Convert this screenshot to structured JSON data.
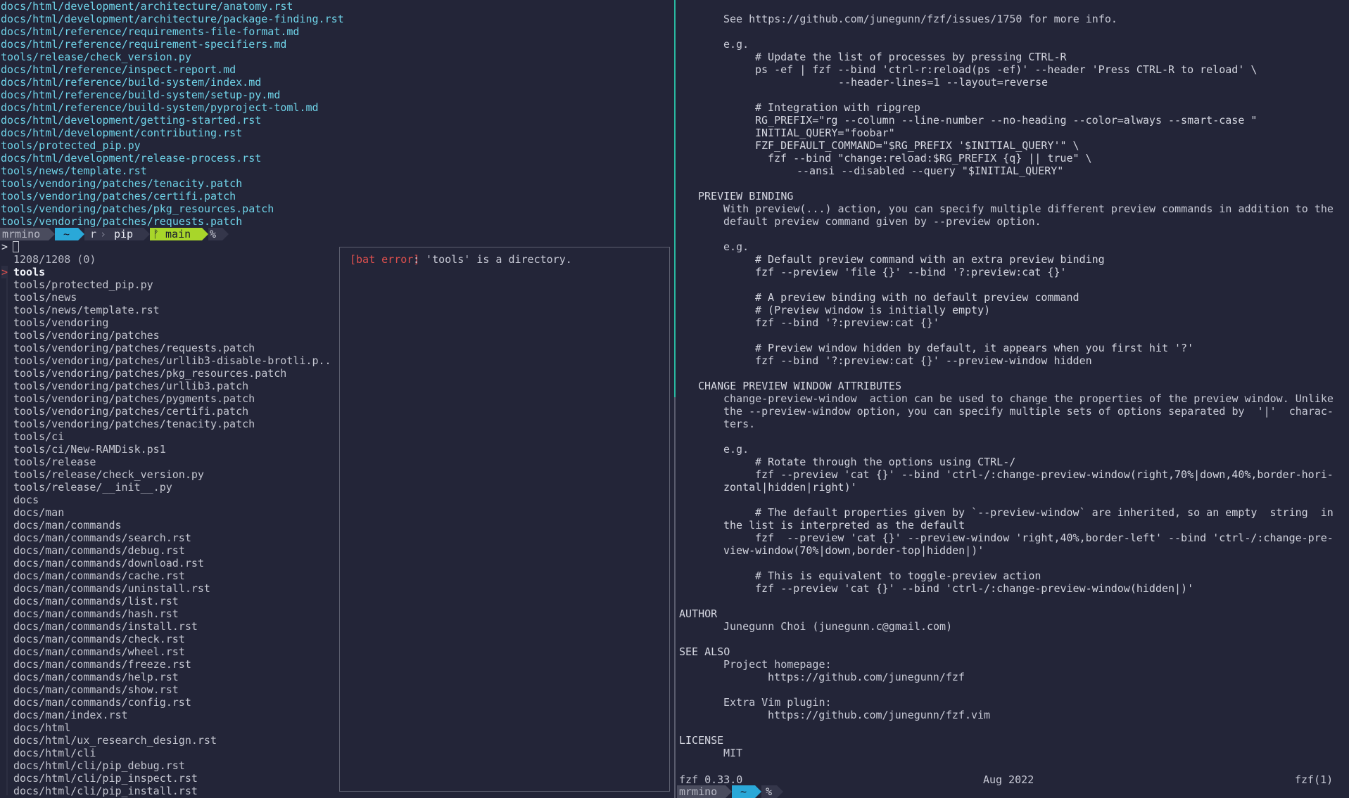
{
  "history_lines": [
    "docs/html/development/architecture/anatomy.rst",
    "docs/html/development/architecture/package-finding.rst",
    "docs/html/reference/requirements-file-format.md",
    "docs/html/reference/requirement-specifiers.md",
    "tools/release/check_version.py",
    "docs/html/reference/inspect-report.md",
    "docs/html/reference/build-system/index.md",
    "docs/html/reference/build-system/setup-py.md",
    "docs/html/reference/build-system/pyproject-toml.md",
    "docs/html/development/getting-started.rst",
    "docs/html/development/contributing.rst",
    "tools/protected_pip.py",
    "docs/html/development/release-process.rst",
    "tools/news/template.rst",
    "tools/vendoring/patches/tenacity.patch",
    "tools/vendoring/patches/certifi.patch",
    "tools/vendoring/patches/pkg_resources.patch",
    "tools/vendoring/patches/requests.patch"
  ],
  "prompt": {
    "user": "mrmino",
    "home": "~",
    "dir1": "r",
    "dir2": "pip",
    "branch": "ᚠ main",
    "symbol": "%"
  },
  "fzf": {
    "query_prompt": ">",
    "count": "1208/1208 (0)",
    "pointer": ">",
    "selected": "tools",
    "items": [
      "tools/protected_pip.py",
      "tools/news",
      "tools/news/template.rst",
      "tools/vendoring",
      "tools/vendoring/patches",
      "tools/vendoring/patches/requests.patch",
      "tools/vendoring/patches/urllib3-disable-brotli.p..",
      "tools/vendoring/patches/pkg_resources.patch",
      "tools/vendoring/patches/urllib3.patch",
      "tools/vendoring/patches/pygments.patch",
      "tools/vendoring/patches/certifi.patch",
      "tools/vendoring/patches/tenacity.patch",
      "tools/ci",
      "tools/ci/New-RAMDisk.ps1",
      "tools/release",
      "tools/release/check_version.py",
      "tools/release/__init__.py",
      "docs",
      "docs/man",
      "docs/man/commands",
      "docs/man/commands/search.rst",
      "docs/man/commands/debug.rst",
      "docs/man/commands/download.rst",
      "docs/man/commands/cache.rst",
      "docs/man/commands/uninstall.rst",
      "docs/man/commands/list.rst",
      "docs/man/commands/hash.rst",
      "docs/man/commands/install.rst",
      "docs/man/commands/check.rst",
      "docs/man/commands/wheel.rst",
      "docs/man/commands/freeze.rst",
      "docs/man/commands/help.rst",
      "docs/man/commands/show.rst",
      "docs/man/commands/config.rst",
      "docs/man/index.rst",
      "docs/html",
      "docs/html/ux_research_design.rst",
      "docs/html/cli",
      "docs/html/cli/pip_debug.rst",
      "docs/html/cli/pip_inspect.rst",
      "docs/html/cli/pip_install.rst"
    ],
    "preview_error_tag": "[bat error]",
    "preview_error_msg": ": 'tools' is a directory."
  },
  "manpage": {
    "lines": [
      {
        "indent": 66,
        "kind": "text",
        "text": "See https://github.com/junegunn/fzf/issues/1750 for more info."
      },
      {
        "indent": 0,
        "kind": "blank",
        "text": ""
      },
      {
        "indent": 66,
        "kind": "text",
        "text": "e.g."
      },
      {
        "indent": 111,
        "kind": "code",
        "text": "# Update the list of processes by pressing CTRL-R"
      },
      {
        "indent": 111,
        "kind": "code",
        "text": "ps -ef | fzf --bind 'ctrl-r:reload(ps -ef)' --header 'Press CTRL-R to reload' \\"
      },
      {
        "indent": 229,
        "kind": "code",
        "text": "--header-lines=1 --layout=reverse"
      },
      {
        "indent": 0,
        "kind": "blank",
        "text": ""
      },
      {
        "indent": 111,
        "kind": "code",
        "text": "# Integration with ripgrep"
      },
      {
        "indent": 111,
        "kind": "code",
        "text": "RG_PREFIX=\"rg --column --line-number --no-heading --color=always --smart-case \""
      },
      {
        "indent": 111,
        "kind": "code",
        "text": "INITIAL_QUERY=\"foobar\""
      },
      {
        "indent": 111,
        "kind": "code",
        "text": "FZF_DEFAULT_COMMAND=\"$RG_PREFIX '$INITIAL_QUERY'\" \\"
      },
      {
        "indent": 129,
        "kind": "code",
        "text": "fzf --bind \"change:reload:$RG_PREFIX {q} || true\" \\"
      },
      {
        "indent": 170,
        "kind": "code",
        "text": "--ansi --disabled --query \"$INITIAL_QUERY\""
      },
      {
        "indent": 0,
        "kind": "blank",
        "text": ""
      },
      {
        "indent": 30,
        "kind": "heading",
        "text": "PREVIEW BINDING"
      },
      {
        "indent": 66,
        "kind": "text",
        "text": "With preview(...) action, you can specify multiple different preview commands in addition to the"
      },
      {
        "indent": 66,
        "kind": "text",
        "text": "default preview command given by --preview option."
      },
      {
        "indent": 0,
        "kind": "blank",
        "text": ""
      },
      {
        "indent": 66,
        "kind": "text",
        "text": "e.g."
      },
      {
        "indent": 111,
        "kind": "code",
        "text": "# Default preview command with an extra preview binding"
      },
      {
        "indent": 111,
        "kind": "code",
        "text": "fzf --preview 'file {}' --bind '?:preview:cat {}'"
      },
      {
        "indent": 0,
        "kind": "blank",
        "text": ""
      },
      {
        "indent": 111,
        "kind": "code",
        "text": "# A preview binding with no default preview command"
      },
      {
        "indent": 111,
        "kind": "code",
        "text": "# (Preview window is initially empty)"
      },
      {
        "indent": 111,
        "kind": "code",
        "text": "fzf --bind '?:preview:cat {}'"
      },
      {
        "indent": 0,
        "kind": "blank",
        "text": ""
      },
      {
        "indent": 111,
        "kind": "code",
        "text": "# Preview window hidden by default, it appears when you first hit '?'"
      },
      {
        "indent": 111,
        "kind": "code",
        "text": "fzf --bind '?:preview:cat {}' --preview-window hidden"
      },
      {
        "indent": 0,
        "kind": "blank",
        "text": ""
      },
      {
        "indent": 30,
        "kind": "heading",
        "text": "CHANGE PREVIEW WINDOW ATTRIBUTES"
      },
      {
        "indent": 66,
        "kind": "text",
        "text": "change-preview-window  action can be used to change the properties of the preview window. Unlike"
      },
      {
        "indent": 66,
        "kind": "text",
        "text": "the --preview-window option, you can specify multiple sets of options separated by  '|'  charac-"
      },
      {
        "indent": 66,
        "kind": "text",
        "text": "ters."
      },
      {
        "indent": 0,
        "kind": "blank",
        "text": ""
      },
      {
        "indent": 66,
        "kind": "text",
        "text": "e.g."
      },
      {
        "indent": 111,
        "kind": "code",
        "text": "# Rotate through the options using CTRL-/"
      },
      {
        "indent": 111,
        "kind": "code",
        "text": "fzf --preview 'cat {}' --bind 'ctrl-/:change-preview-window(right,70%|down,40%,border-hori-"
      },
      {
        "indent": 66,
        "kind": "code",
        "text": "zontal|hidden|right)'"
      },
      {
        "indent": 0,
        "kind": "blank",
        "text": ""
      },
      {
        "indent": 111,
        "kind": "code",
        "text": "# The default properties given by `--preview-window` are inherited, so an empty  string  in"
      },
      {
        "indent": 66,
        "kind": "code",
        "text": "the list is interpreted as the default"
      },
      {
        "indent": 111,
        "kind": "code",
        "text": "fzf  --preview 'cat {}' --preview-window 'right,40%,border-left' --bind 'ctrl-/:change-pre-"
      },
      {
        "indent": 66,
        "kind": "code",
        "text": "view-window(70%|down,border-top|hidden|)'"
      },
      {
        "indent": 0,
        "kind": "blank",
        "text": ""
      },
      {
        "indent": 111,
        "kind": "code",
        "text": "# This is equivalent to toggle-preview action"
      },
      {
        "indent": 111,
        "kind": "code",
        "text": "fzf --preview 'cat {}' --bind 'ctrl-/:change-preview-window(hidden|)'"
      },
      {
        "indent": 0,
        "kind": "blank",
        "text": ""
      },
      {
        "indent": 3,
        "kind": "heading",
        "text": "AUTHOR"
      },
      {
        "indent": 66,
        "kind": "text",
        "text": "Junegunn Choi (junegunn.c@gmail.com)"
      },
      {
        "indent": 0,
        "kind": "blank",
        "text": ""
      },
      {
        "indent": 3,
        "kind": "heading",
        "text": "SEE ALSO"
      },
      {
        "indent": 66,
        "kind": "text",
        "text": "Project homepage:"
      },
      {
        "indent": 129,
        "kind": "text",
        "text": "https://github.com/junegunn/fzf"
      },
      {
        "indent": 0,
        "kind": "blank",
        "text": ""
      },
      {
        "indent": 66,
        "kind": "text",
        "text": "Extra Vim plugin:"
      },
      {
        "indent": 129,
        "kind": "text",
        "text": "https://github.com/junegunn/fzf.vim"
      },
      {
        "indent": 0,
        "kind": "blank",
        "text": ""
      },
      {
        "indent": 3,
        "kind": "heading",
        "text": "LICENSE"
      },
      {
        "indent": 66,
        "kind": "text",
        "text": "MIT"
      }
    ],
    "footer_left": "fzf 0.33.0",
    "footer_center": "Aug 2022",
    "footer_right": "fzf(1)"
  },
  "right_prompt": {
    "user": "mrmino",
    "home": "~",
    "symbol": "%"
  },
  "colors": {
    "background": "#232538",
    "history_text": "#6fd3e8",
    "prompt_user_bg": "#4a4c5e",
    "prompt_home_bg": "#2aa8d8",
    "prompt_dir_bg": "#34364a",
    "prompt_branch_bg": "#a8d62a",
    "error_red": "#e0504e",
    "active_divider": "#29b8a0"
  }
}
